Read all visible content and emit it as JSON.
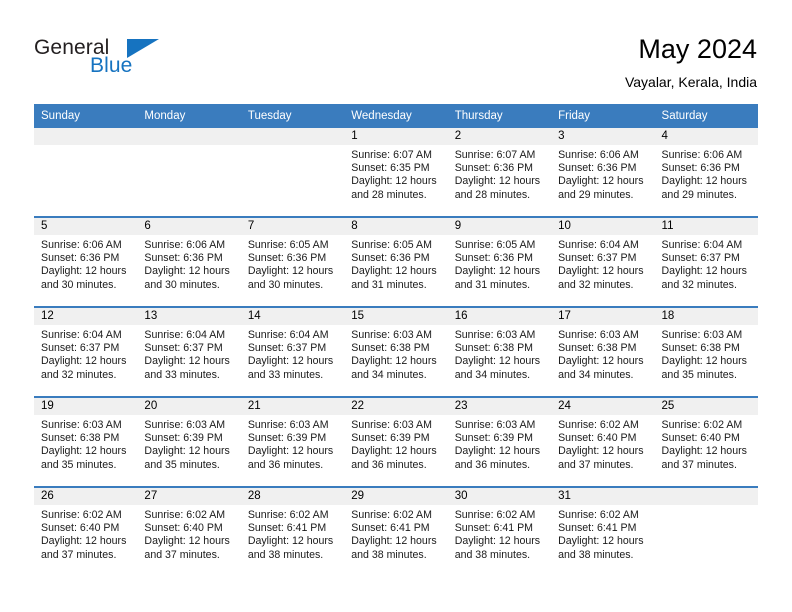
{
  "brand": {
    "name_part1": "General",
    "name_part2": "Blue",
    "triangle_icon": "triangle-icon",
    "accent_color": "#1673c0"
  },
  "header": {
    "month_title": "May 2024",
    "location": "Vayalar, Kerala, India",
    "header_bg_color": "#3a7cbe"
  },
  "calendar": {
    "weekday_headers": [
      "Sunday",
      "Monday",
      "Tuesday",
      "Wednesday",
      "Thursday",
      "Friday",
      "Saturday"
    ],
    "weeks": [
      [
        {
          "day": "",
          "sunrise": "",
          "sunset": "",
          "daylight": ""
        },
        {
          "day": "",
          "sunrise": "",
          "sunset": "",
          "daylight": ""
        },
        {
          "day": "",
          "sunrise": "",
          "sunset": "",
          "daylight": ""
        },
        {
          "day": "1",
          "sunrise": "Sunrise: 6:07 AM",
          "sunset": "Sunset: 6:35 PM",
          "daylight": "Daylight: 12 hours and 28 minutes."
        },
        {
          "day": "2",
          "sunrise": "Sunrise: 6:07 AM",
          "sunset": "Sunset: 6:36 PM",
          "daylight": "Daylight: 12 hours and 28 minutes."
        },
        {
          "day": "3",
          "sunrise": "Sunrise: 6:06 AM",
          "sunset": "Sunset: 6:36 PM",
          "daylight": "Daylight: 12 hours and 29 minutes."
        },
        {
          "day": "4",
          "sunrise": "Sunrise: 6:06 AM",
          "sunset": "Sunset: 6:36 PM",
          "daylight": "Daylight: 12 hours and 29 minutes."
        }
      ],
      [
        {
          "day": "5",
          "sunrise": "Sunrise: 6:06 AM",
          "sunset": "Sunset: 6:36 PM",
          "daylight": "Daylight: 12 hours and 30 minutes."
        },
        {
          "day": "6",
          "sunrise": "Sunrise: 6:06 AM",
          "sunset": "Sunset: 6:36 PM",
          "daylight": "Daylight: 12 hours and 30 minutes."
        },
        {
          "day": "7",
          "sunrise": "Sunrise: 6:05 AM",
          "sunset": "Sunset: 6:36 PM",
          "daylight": "Daylight: 12 hours and 30 minutes."
        },
        {
          "day": "8",
          "sunrise": "Sunrise: 6:05 AM",
          "sunset": "Sunset: 6:36 PM",
          "daylight": "Daylight: 12 hours and 31 minutes."
        },
        {
          "day": "9",
          "sunrise": "Sunrise: 6:05 AM",
          "sunset": "Sunset: 6:36 PM",
          "daylight": "Daylight: 12 hours and 31 minutes."
        },
        {
          "day": "10",
          "sunrise": "Sunrise: 6:04 AM",
          "sunset": "Sunset: 6:37 PM",
          "daylight": "Daylight: 12 hours and 32 minutes."
        },
        {
          "day": "11",
          "sunrise": "Sunrise: 6:04 AM",
          "sunset": "Sunset: 6:37 PM",
          "daylight": "Daylight: 12 hours and 32 minutes."
        }
      ],
      [
        {
          "day": "12",
          "sunrise": "Sunrise: 6:04 AM",
          "sunset": "Sunset: 6:37 PM",
          "daylight": "Daylight: 12 hours and 32 minutes."
        },
        {
          "day": "13",
          "sunrise": "Sunrise: 6:04 AM",
          "sunset": "Sunset: 6:37 PM",
          "daylight": "Daylight: 12 hours and 33 minutes."
        },
        {
          "day": "14",
          "sunrise": "Sunrise: 6:04 AM",
          "sunset": "Sunset: 6:37 PM",
          "daylight": "Daylight: 12 hours and 33 minutes."
        },
        {
          "day": "15",
          "sunrise": "Sunrise: 6:03 AM",
          "sunset": "Sunset: 6:38 PM",
          "daylight": "Daylight: 12 hours and 34 minutes."
        },
        {
          "day": "16",
          "sunrise": "Sunrise: 6:03 AM",
          "sunset": "Sunset: 6:38 PM",
          "daylight": "Daylight: 12 hours and 34 minutes."
        },
        {
          "day": "17",
          "sunrise": "Sunrise: 6:03 AM",
          "sunset": "Sunset: 6:38 PM",
          "daylight": "Daylight: 12 hours and 34 minutes."
        },
        {
          "day": "18",
          "sunrise": "Sunrise: 6:03 AM",
          "sunset": "Sunset: 6:38 PM",
          "daylight": "Daylight: 12 hours and 35 minutes."
        }
      ],
      [
        {
          "day": "19",
          "sunrise": "Sunrise: 6:03 AM",
          "sunset": "Sunset: 6:38 PM",
          "daylight": "Daylight: 12 hours and 35 minutes."
        },
        {
          "day": "20",
          "sunrise": "Sunrise: 6:03 AM",
          "sunset": "Sunset: 6:39 PM",
          "daylight": "Daylight: 12 hours and 35 minutes."
        },
        {
          "day": "21",
          "sunrise": "Sunrise: 6:03 AM",
          "sunset": "Sunset: 6:39 PM",
          "daylight": "Daylight: 12 hours and 36 minutes."
        },
        {
          "day": "22",
          "sunrise": "Sunrise: 6:03 AM",
          "sunset": "Sunset: 6:39 PM",
          "daylight": "Daylight: 12 hours and 36 minutes."
        },
        {
          "day": "23",
          "sunrise": "Sunrise: 6:03 AM",
          "sunset": "Sunset: 6:39 PM",
          "daylight": "Daylight: 12 hours and 36 minutes."
        },
        {
          "day": "24",
          "sunrise": "Sunrise: 6:02 AM",
          "sunset": "Sunset: 6:40 PM",
          "daylight": "Daylight: 12 hours and 37 minutes."
        },
        {
          "day": "25",
          "sunrise": "Sunrise: 6:02 AM",
          "sunset": "Sunset: 6:40 PM",
          "daylight": "Daylight: 12 hours and 37 minutes."
        }
      ],
      [
        {
          "day": "26",
          "sunrise": "Sunrise: 6:02 AM",
          "sunset": "Sunset: 6:40 PM",
          "daylight": "Daylight: 12 hours and 37 minutes."
        },
        {
          "day": "27",
          "sunrise": "Sunrise: 6:02 AM",
          "sunset": "Sunset: 6:40 PM",
          "daylight": "Daylight: 12 hours and 37 minutes."
        },
        {
          "day": "28",
          "sunrise": "Sunrise: 6:02 AM",
          "sunset": "Sunset: 6:41 PM",
          "daylight": "Daylight: 12 hours and 38 minutes."
        },
        {
          "day": "29",
          "sunrise": "Sunrise: 6:02 AM",
          "sunset": "Sunset: 6:41 PM",
          "daylight": "Daylight: 12 hours and 38 minutes."
        },
        {
          "day": "30",
          "sunrise": "Sunrise: 6:02 AM",
          "sunset": "Sunset: 6:41 PM",
          "daylight": "Daylight: 12 hours and 38 minutes."
        },
        {
          "day": "31",
          "sunrise": "Sunrise: 6:02 AM",
          "sunset": "Sunset: 6:41 PM",
          "daylight": "Daylight: 12 hours and 38 minutes."
        },
        {
          "day": "",
          "sunrise": "",
          "sunset": "",
          "daylight": ""
        }
      ]
    ]
  }
}
